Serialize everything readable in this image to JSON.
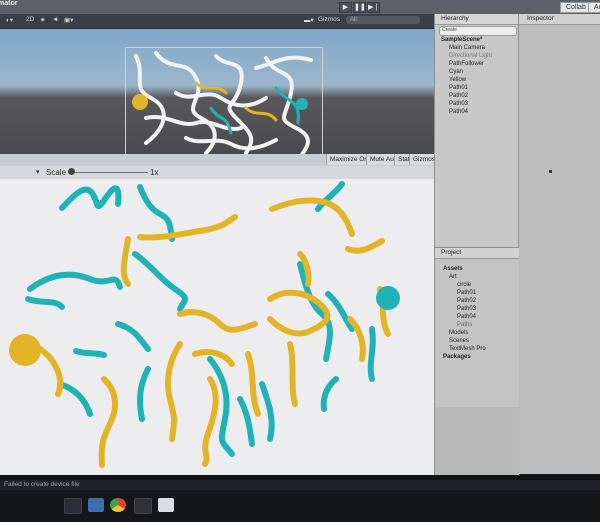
{
  "toolbar": {
    "title_partial": "mator",
    "collab_label": "Collab",
    "account_label": "Acc",
    "play": "▶",
    "pause": "❚❚",
    "step": "▶❘"
  },
  "scene": {
    "gizmos_label": "Gizmos",
    "search_placeholder": "All"
  },
  "game": {
    "maximize_label": "Maximize On Play",
    "mute_label": "Mute Audio",
    "stats_label": "Stats",
    "gizmos_label": "Gizmos",
    "scale_label": "Scale",
    "scale_value": "1x"
  },
  "hierarchy": {
    "title": "Hierarchy",
    "create_label": "Create",
    "items": [
      "SampleScene*",
      "Main Camera",
      "Directional Light",
      "PathFollower",
      "Cyan",
      "Yellow",
      "Path01",
      "Path02",
      "Path03",
      "Path04"
    ]
  },
  "inspector": {
    "title": "Inspector"
  },
  "project": {
    "title": "Project",
    "tree": [
      "Assets",
      "Art",
      "circle",
      "Path01",
      "Path02",
      "Path03",
      "Path04",
      "Paths",
      "Models",
      "Scenes",
      "TextMesh Pro",
      "Packages"
    ]
  },
  "console": {
    "message": "Failed to create device file"
  },
  "colors": {
    "cyan": "#1fb3b7",
    "yellow": "#e3b427",
    "game_bg": "#ededef",
    "editor_bg": "#c8c8c8"
  }
}
